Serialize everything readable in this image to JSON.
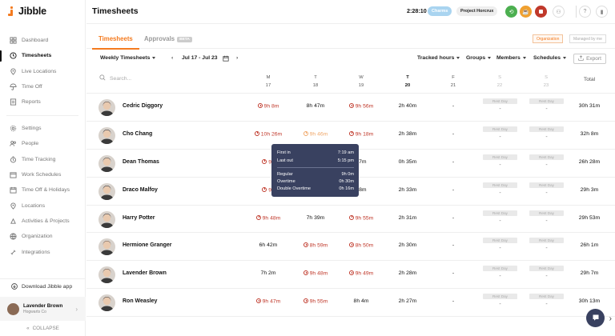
{
  "brand": {
    "name": "Jibble",
    "accent": "#f47b20"
  },
  "sidebar": {
    "primary": [
      {
        "label": "Dashboard",
        "icon": "dashboard-icon",
        "active": false
      },
      {
        "label": "Timesheets",
        "icon": "clock-icon",
        "active": true
      },
      {
        "label": "Live Locations",
        "icon": "location-pin-icon",
        "active": false
      },
      {
        "label": "Time Off",
        "icon": "umbrella-icon",
        "active": false
      },
      {
        "label": "Reports",
        "icon": "report-icon",
        "active": false
      }
    ],
    "secondary": [
      {
        "label": "Settings",
        "icon": "gear-icon"
      },
      {
        "label": "People",
        "icon": "people-icon"
      },
      {
        "label": "Time Tracking",
        "icon": "time-tracking-icon"
      },
      {
        "label": "Work Schedules",
        "icon": "schedule-icon"
      },
      {
        "label": "Time Off & Holidays",
        "icon": "calendar-icon"
      },
      {
        "label": "Locations",
        "icon": "location-pin-icon"
      },
      {
        "label": "Activities & Projects",
        "icon": "activities-icon"
      },
      {
        "label": "Organization",
        "icon": "organization-icon"
      },
      {
        "label": "Integrations",
        "icon": "integrations-icon"
      }
    ],
    "download_label": "Download Jibble app",
    "user": {
      "name": "Lavender Brown",
      "org": "Hogwarts Co"
    },
    "collapse_label": "COLLAPSE"
  },
  "header": {
    "title": "Timesheets",
    "timer": "2:28:10",
    "activity_chip": "Charms",
    "project_chip": "Project Horcrux"
  },
  "tabs": {
    "timesheets": "Timesheets",
    "approvals": "Approvals",
    "beta": "BETA",
    "scope_org": "Organization",
    "scope_managed": "Managed by me"
  },
  "filters": {
    "view": "Weekly Timesheets",
    "date_range": "Jul 17 - Jul 23",
    "tracked_hours": "Tracked hours",
    "groups": "Groups",
    "members": "Members",
    "schedules": "Schedules",
    "export": "Export"
  },
  "table": {
    "search_placeholder": "Search...",
    "days": [
      {
        "dow": "M",
        "date": "17"
      },
      {
        "dow": "T",
        "date": "18"
      },
      {
        "dow": "W",
        "date": "19"
      },
      {
        "dow": "T",
        "date": "20"
      },
      {
        "dow": "F",
        "date": "21"
      },
      {
        "dow": "S",
        "date": "22"
      },
      {
        "dow": "S",
        "date": "23"
      }
    ],
    "total_header": "Total",
    "rest_day_label": "Rest Day",
    "rows": [
      {
        "name": "Cedric Diggory",
        "cells": [
          "9h 8m",
          "8h 47m",
          "9h 56m",
          "2h 40m",
          "-"
        ],
        "warn": [
          true,
          false,
          true,
          false,
          false
        ],
        "total": "30h 31m"
      },
      {
        "name": "Cho Chang",
        "cells": [
          "10h 26m",
          "9h 46m",
          "9h 18m",
          "2h 38m",
          "-"
        ],
        "warn": [
          true,
          true,
          true,
          false,
          false
        ],
        "total": "32h 8m"
      },
      {
        "name": "Dean Thomas",
        "cells": [
          "9h",
          "",
          "17m",
          "0h 35m",
          "-"
        ],
        "warn": [
          true,
          false,
          false,
          false,
          false
        ],
        "total": "26h 28m"
      },
      {
        "name": "Draco Malfoy",
        "cells": [
          "9h",
          "",
          "18m",
          "2h 33m",
          "-"
        ],
        "warn": [
          true,
          false,
          false,
          false,
          false
        ],
        "total": "29h 3m"
      },
      {
        "name": "Harry Potter",
        "cells": [
          "9h 48m",
          "7h 39m",
          "9h 55m",
          "2h 31m",
          "-"
        ],
        "warn": [
          true,
          false,
          true,
          false,
          false
        ],
        "total": "29h 53m"
      },
      {
        "name": "Hermione Granger",
        "cells": [
          "6h 42m",
          "8h 59m",
          "8h 50m",
          "2h 30m",
          "-"
        ],
        "warn": [
          false,
          true,
          true,
          false,
          false
        ],
        "total": "26h 1m"
      },
      {
        "name": "Lavender Brown",
        "cells": [
          "7h 2m",
          "9h 48m",
          "9h 49m",
          "2h 28m",
          "-"
        ],
        "warn": [
          false,
          true,
          true,
          false,
          false
        ],
        "total": "29h 7m"
      },
      {
        "name": "Ron Weasley",
        "cells": [
          "9h 47m",
          "9h 55m",
          "8h 4m",
          "2h 27m",
          "-"
        ],
        "warn": [
          true,
          true,
          false,
          false,
          false
        ],
        "total": "30h 13m"
      }
    ]
  },
  "tooltip": {
    "first_in_label": "First in",
    "first_in": "7:19 am",
    "last_out_label": "Last out",
    "last_out": "5:15 pm",
    "regular_label": "Regular",
    "regular": "9h 0m",
    "overtime_label": "Overtime",
    "overtime": "0h 30m",
    "double_label": "Double Overtime",
    "double": "0h 16m"
  }
}
